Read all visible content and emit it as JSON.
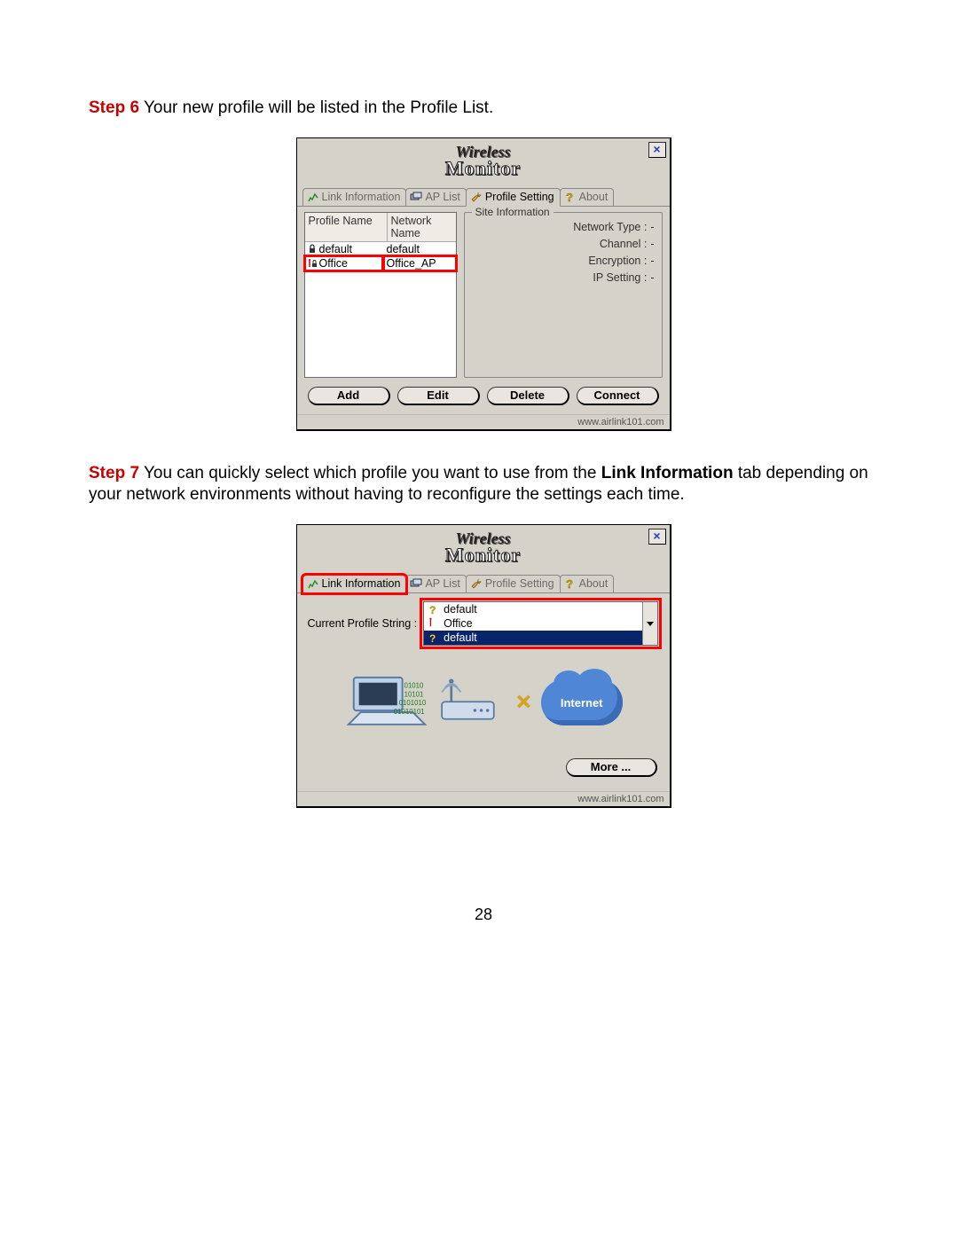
{
  "steps": {
    "s6": {
      "label": "Step 6",
      "text": " Your new profile will be listed in the Profile List."
    },
    "s7": {
      "label": "Step 7",
      "text_a": " You can quickly select which profile you want to use from the ",
      "bold": "Link Information",
      "text_b": " tab depending on your network environments without having to reconfigure the settings each time."
    }
  },
  "app": {
    "title_line1": "Wireless",
    "title_line2": "Monitor",
    "close": "×"
  },
  "tabs": {
    "link_info": "Link Information",
    "ap_list": "AP List",
    "profile_setting": "Profile Setting",
    "about": "About"
  },
  "profile_win": {
    "columns": {
      "profile_name": "Profile Name",
      "network_name": "Network Name"
    },
    "rows": [
      {
        "profile": "default",
        "network": "default"
      },
      {
        "profile": "Office",
        "network": "Office_AP"
      }
    ],
    "site_info": {
      "legend": "Site Information",
      "network_type": "Network Type :",
      "channel": "Channel :",
      "encryption": "Encryption :",
      "ip_setting": "IP Setting :",
      "dash": "-"
    },
    "buttons": {
      "add": "Add",
      "edit": "Edit",
      "delete": "Delete",
      "connect": "Connect"
    }
  },
  "link_win": {
    "current_profile_label": "Current Profile String :",
    "selected": "default",
    "options": [
      "Office",
      "default"
    ],
    "more": "More ...",
    "internet": "Internet"
  },
  "footer_url": "www.airlink101.com",
  "page_number": "28"
}
